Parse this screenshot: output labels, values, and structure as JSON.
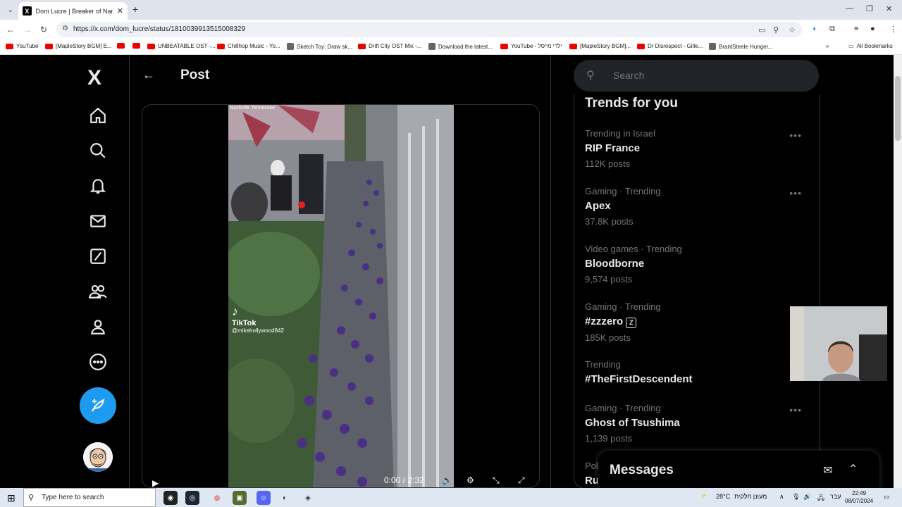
{
  "browser": {
    "tab_title": "Dom Lucre | Breaker of Narrati",
    "tab_favicon": "X",
    "url": "https://x.com/dom_lucre/status/1810039913515008329",
    "bookmarks": [
      {
        "label": "YouTube",
        "icon": "yt"
      },
      {
        "label": "[MapleStory BGM] E...",
        "icon": "yt"
      },
      {
        "label": "",
        "icon": "yt"
      },
      {
        "label": "",
        "icon": "yt"
      },
      {
        "label": "UNBEATABLE OST -...",
        "icon": "yt"
      },
      {
        "label": "Chillhop Music - Yo...",
        "icon": "yt"
      },
      {
        "label": "Sketch Toy: Draw sk...",
        "icon": "gen"
      },
      {
        "label": "Drift City OST Mix -...",
        "icon": "yt"
      },
      {
        "label": "Download the latest...",
        "icon": "gen"
      },
      {
        "label": "YouTube - ילדי מייסל",
        "icon": "yt"
      },
      {
        "label": "[MapleStory BGM]...",
        "icon": "yt"
      },
      {
        "label": "Dr Disrespect - Gille...",
        "icon": "yt"
      },
      {
        "label": "BrantSteele Hunger...",
        "icon": "gen"
      }
    ],
    "all_bookmarks": "All Bookmarks"
  },
  "x": {
    "logo": "X",
    "post_title": "Post",
    "video": {
      "location": "Nashville Tennessee",
      "watermark": "TikTok",
      "handle": "@mikehollywood842",
      "time": "0:00 / 2:32"
    },
    "search_placeholder": "Search",
    "trends_header": "Trends for you",
    "trends": [
      {
        "meta": "Trending in Israel",
        "name": "RIP France",
        "count": "112K posts"
      },
      {
        "meta": "Gaming · Trending",
        "name": "Apex",
        "count": "37.8K posts"
      },
      {
        "meta": "Video games · Trending",
        "name": "Bloodborne",
        "count": "9,574 posts"
      },
      {
        "meta": "Gaming · Trending",
        "name": "#zzzero",
        "count": "185K posts"
      },
      {
        "meta": "Trending",
        "name": "#TheFirstDescendent",
        "count": ""
      },
      {
        "meta": "Gaming · Trending",
        "name": "Ghost of Tsushima",
        "count": "1,139 posts"
      }
    ],
    "partial_trend_meta": "Pol",
    "partial_trend_name": "Ru",
    "messages_title": "Messages"
  },
  "taskbar": {
    "search_placeholder": "Type here to search",
    "weather": "28°C",
    "weather_label": "מעונן חלקית",
    "lang": "עבר",
    "time": "22:49",
    "date": "08/07/2024"
  }
}
